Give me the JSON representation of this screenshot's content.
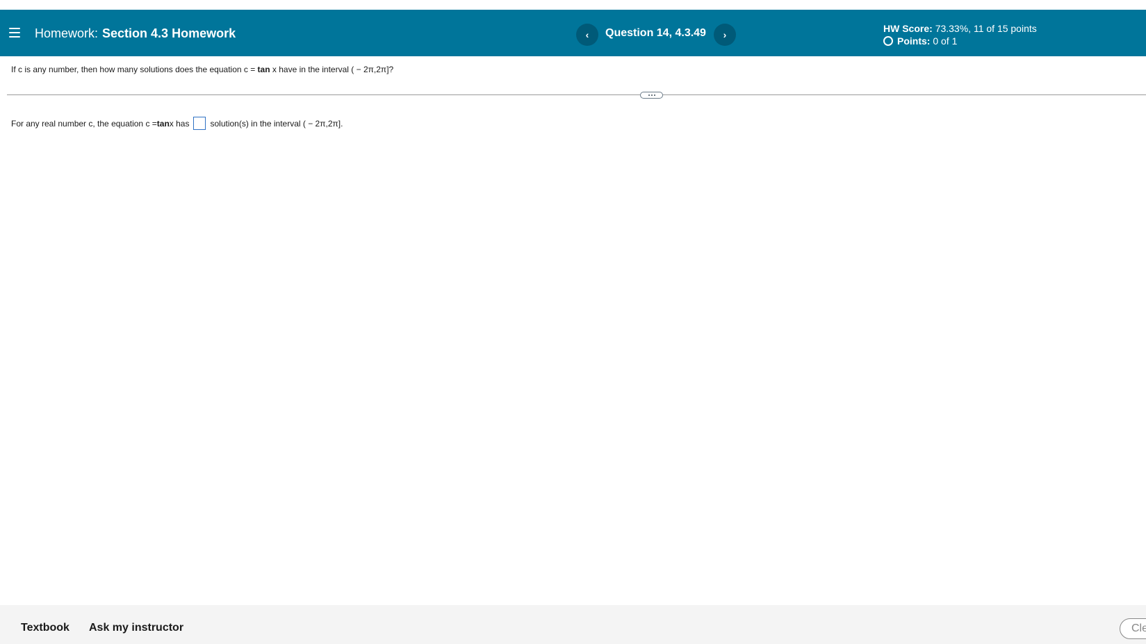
{
  "header": {
    "prefix": "Homework:",
    "title": "Section 4.3 Homework",
    "question": "Question 14, 4.3.49",
    "prev_icon": "‹",
    "next_icon": "›",
    "score_label": "HW Score:",
    "score_value": "73.33%, 11 of 15 points",
    "points_label": "Points:",
    "points_value": "0 of 1"
  },
  "question": {
    "prompt_start": "If c is any number, then how many solutions does the equation c = ",
    "prompt_tan": "tan",
    "prompt_end": " x have in the interval ( − 2π,2π]?",
    "answer_start": "For any real number c, the equation c = ",
    "answer_tan": "tan",
    "answer_mid": " x has",
    "answer_value": "",
    "answer_end": "solution(s) in the interval  ( − 2π,2π]."
  },
  "footer": {
    "textbook": "Textbook",
    "ask": "Ask my instructor",
    "clear": "Cle"
  },
  "colors": {
    "header_bg": "#00759a",
    "nav_button_bg": "#005a78",
    "footer_bg": "#f4f4f4",
    "answer_box_border": "#2f72c4"
  }
}
